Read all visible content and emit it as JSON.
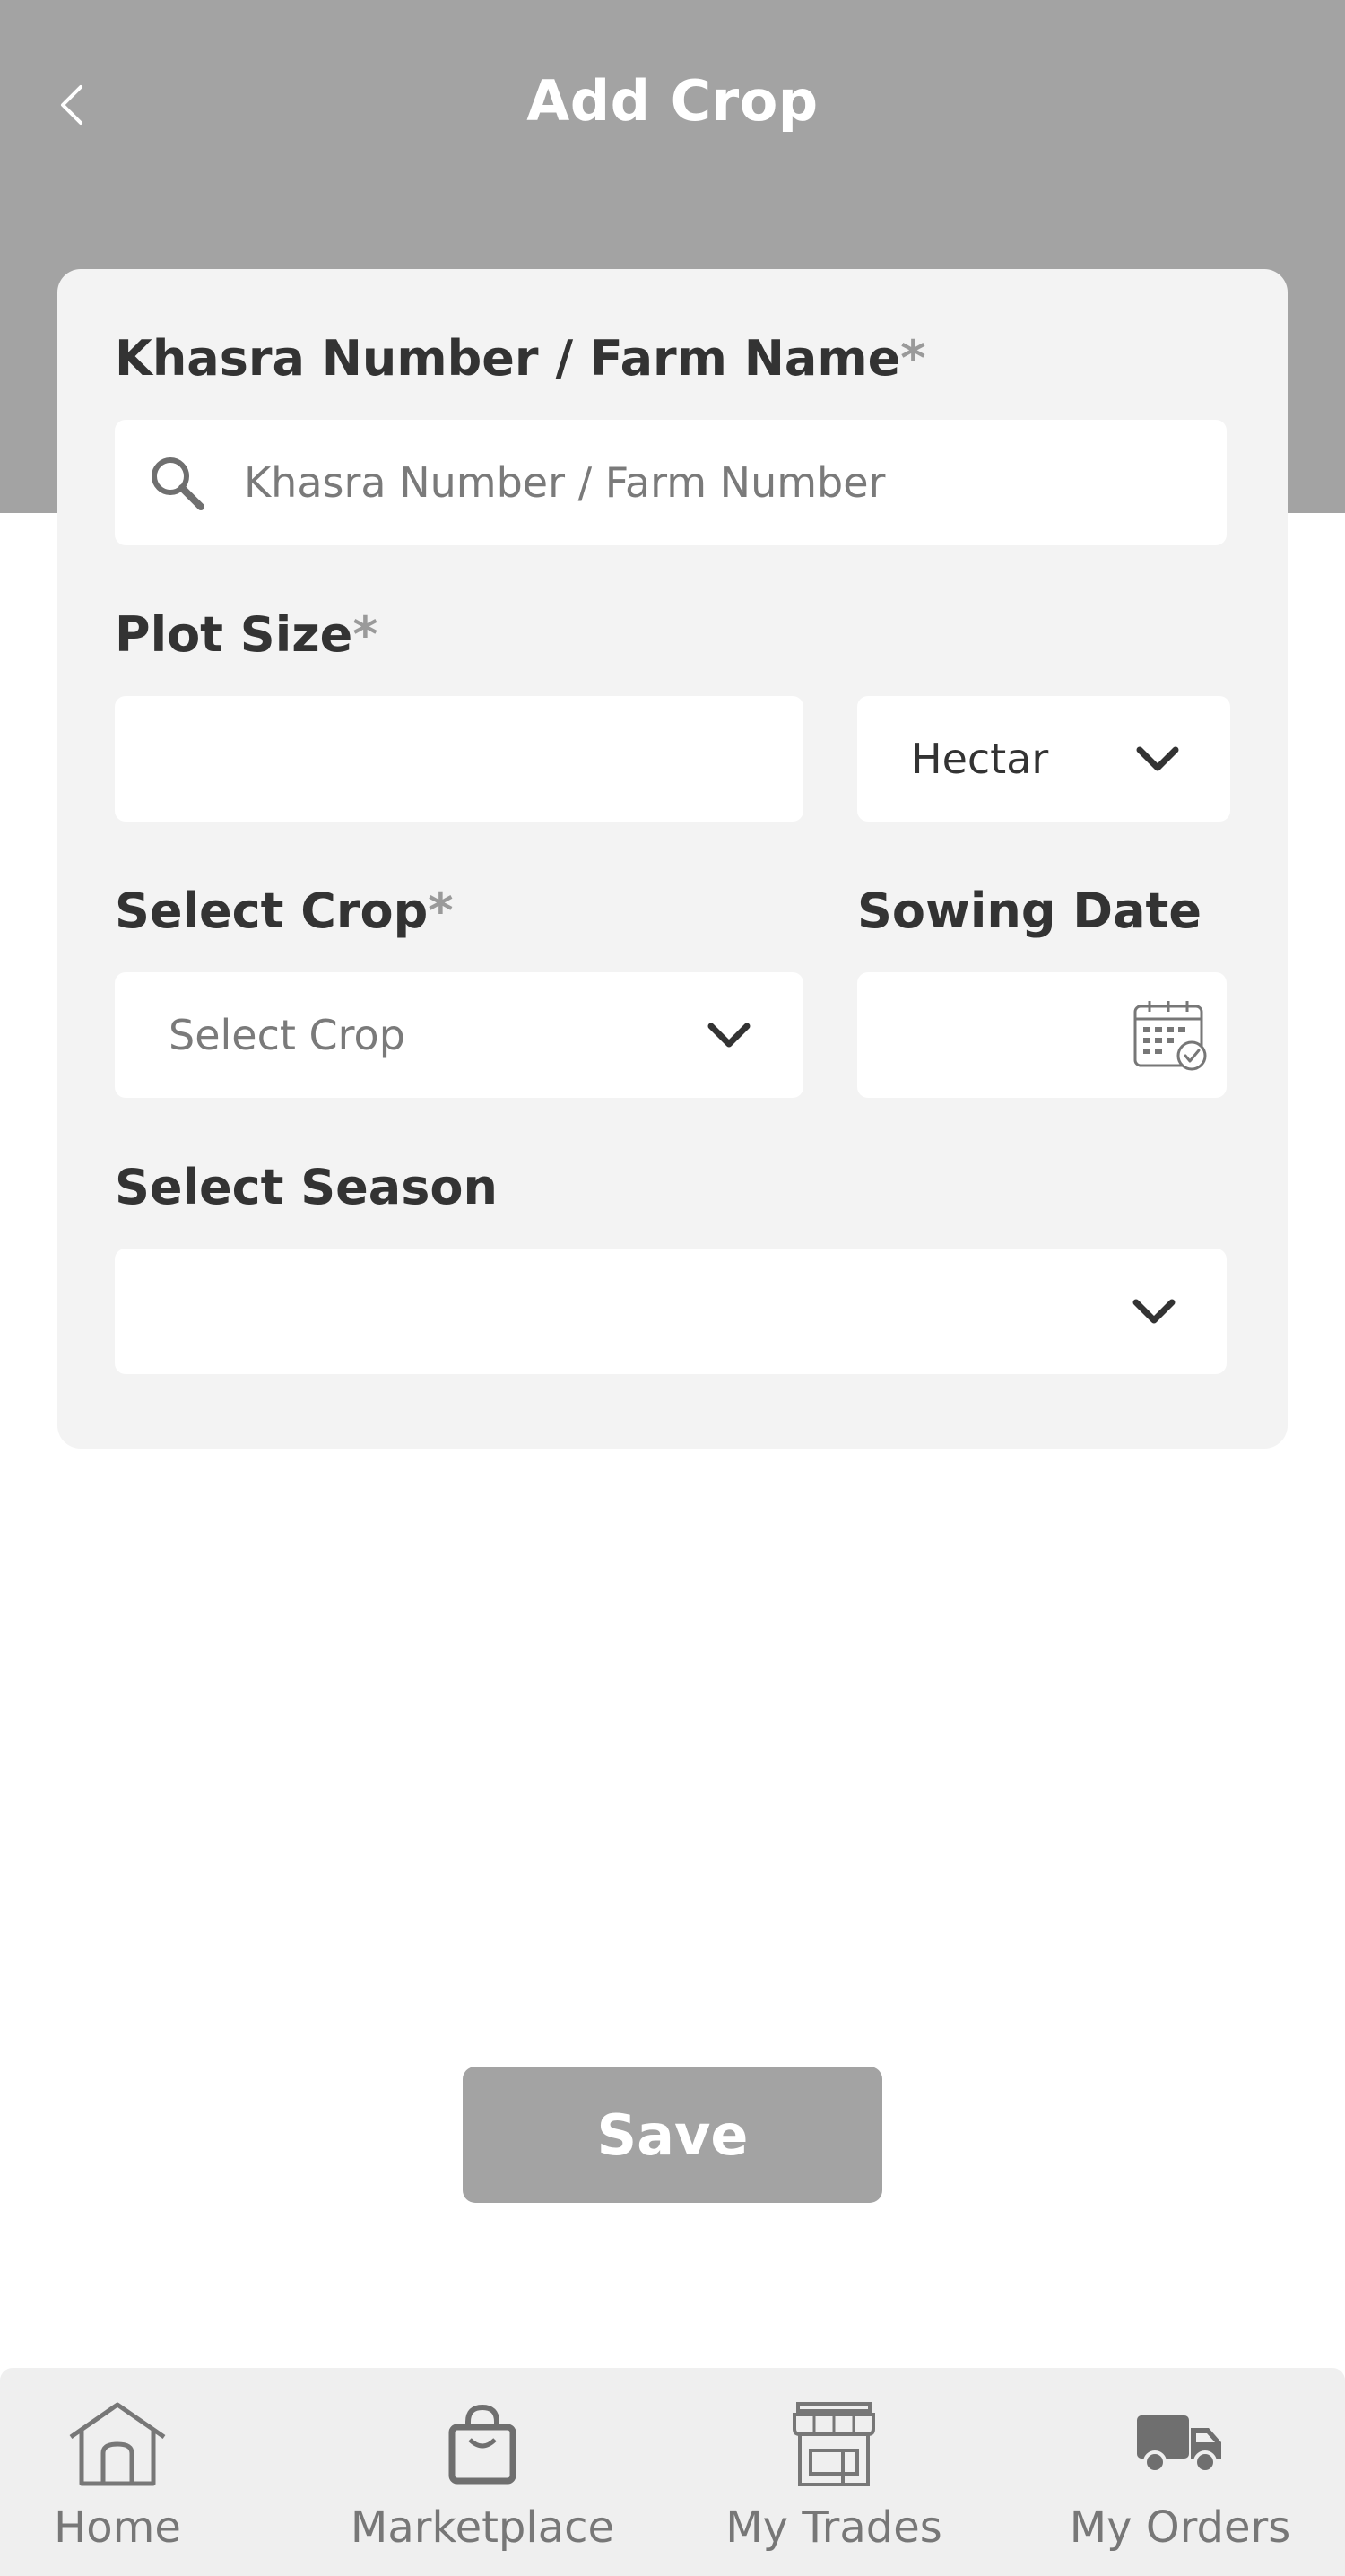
{
  "header": {
    "title": "Add Crop",
    "back_icon": "chevron-left-icon"
  },
  "form": {
    "khasra": {
      "label": "Khasra Number / Farm Name",
      "required_mark": "*",
      "placeholder": "Khasra Number / Farm Number",
      "value": "",
      "icon": "search-icon"
    },
    "plot_size": {
      "label": "Plot Size",
      "required_mark": "*",
      "value": "",
      "unit_selected": "Hectar"
    },
    "crop": {
      "label": "Select Crop",
      "required_mark": "*",
      "placeholder": "Select Crop"
    },
    "sowing_date": {
      "label": "Sowing Date",
      "value": "",
      "icon": "calendar-check-icon"
    },
    "season": {
      "label": "Select Season",
      "value": ""
    }
  },
  "actions": {
    "save_label": "Save"
  },
  "bottom_nav": {
    "items": [
      {
        "label": "Home",
        "icon": "home-icon"
      },
      {
        "label": "Marketplace",
        "icon": "shopping-bag-icon"
      },
      {
        "label": "My Trades",
        "icon": "store-icon"
      },
      {
        "label": "My Orders",
        "icon": "truck-icon"
      }
    ]
  },
  "colors": {
    "header_bg": "#a3a3a3",
    "card_bg": "#f3f3f3",
    "button_bg": "#a3a3a3",
    "nav_bg": "#efefef",
    "label_text": "#333333"
  }
}
